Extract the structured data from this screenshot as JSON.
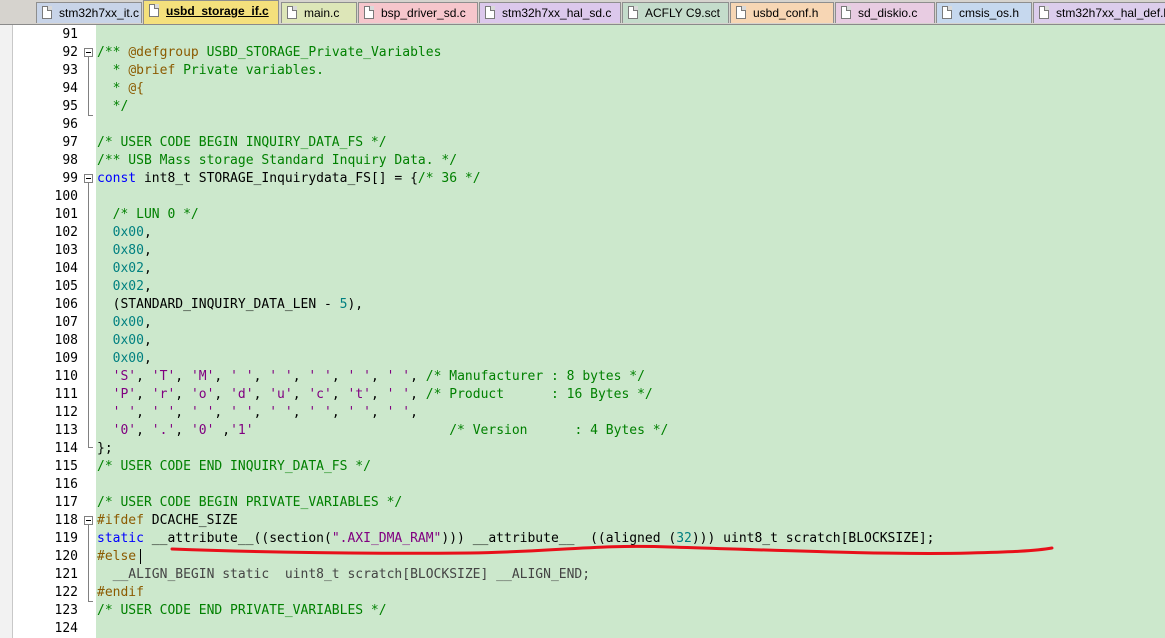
{
  "tabs": [
    {
      "label": "stm32h7xx_it.c",
      "color": "#c8d4e8",
      "active": false
    },
    {
      "label": "usbd_storage_if.c",
      "color": "#f4e07c",
      "active": true
    },
    {
      "label": "main.c",
      "color": "#dde6b8",
      "active": false
    },
    {
      "label": "bsp_driver_sd.c",
      "color": "#f6c6cc",
      "active": false
    },
    {
      "label": "stm32h7xx_hal_sd.c",
      "color": "#dcc8ec",
      "active": false
    },
    {
      "label": "ACFLY C9.sct",
      "color": "#c4dccb",
      "active": false
    },
    {
      "label": "usbd_conf.h",
      "color": "#f7d6b4",
      "active": false
    },
    {
      "label": "sd_diskio.c",
      "color": "#e8cce2",
      "active": false
    },
    {
      "label": "cmsis_os.h",
      "color": "#c6d8ee",
      "active": false
    },
    {
      "label": "stm32h7xx_hal_def.h",
      "color": "#dccdec",
      "active": false
    }
  ],
  "editor": {
    "lines": [
      {
        "n": "91",
        "segs": []
      },
      {
        "n": "92",
        "segs": [
          {
            "t": "/** ",
            "c": "com"
          },
          {
            "t": "@defgroup",
            "c": "pp"
          },
          {
            "t": " USBD_STORAGE_Private_Variables",
            "c": "com"
          }
        ]
      },
      {
        "n": "93",
        "segs": [
          {
            "t": "  * ",
            "c": "com"
          },
          {
            "t": "@brief",
            "c": "pp"
          },
          {
            "t": " Private variables.",
            "c": "com"
          }
        ]
      },
      {
        "n": "94",
        "segs": [
          {
            "t": "  * ",
            "c": "com"
          },
          {
            "t": "@{",
            "c": "pp"
          }
        ]
      },
      {
        "n": "95",
        "segs": [
          {
            "t": "  */",
            "c": "com"
          }
        ]
      },
      {
        "n": "96",
        "segs": []
      },
      {
        "n": "97",
        "segs": [
          {
            "t": "/* USER CODE BEGIN INQUIRY_DATA_FS */",
            "c": "com"
          }
        ]
      },
      {
        "n": "98",
        "segs": [
          {
            "t": "/** USB Mass storage Standard Inquiry Data. */",
            "c": "com"
          }
        ]
      },
      {
        "n": "99",
        "segs": [
          {
            "t": "const",
            "c": "kw"
          },
          {
            "t": " int8_t STORAGE_Inquirydata_FS[] = {",
            "c": "txt"
          },
          {
            "t": "/* 36 */",
            "c": "com"
          }
        ]
      },
      {
        "n": "100",
        "segs": []
      },
      {
        "n": "101",
        "segs": [
          {
            "t": "  /* LUN 0 */",
            "c": "com"
          }
        ]
      },
      {
        "n": "102",
        "segs": [
          {
            "t": "  0x00",
            "c": "num"
          },
          {
            "t": ",",
            "c": "txt"
          }
        ]
      },
      {
        "n": "103",
        "segs": [
          {
            "t": "  0x80",
            "c": "num"
          },
          {
            "t": ",",
            "c": "txt"
          }
        ]
      },
      {
        "n": "104",
        "segs": [
          {
            "t": "  0x02",
            "c": "num"
          },
          {
            "t": ",",
            "c": "txt"
          }
        ]
      },
      {
        "n": "105",
        "segs": [
          {
            "t": "  0x02",
            "c": "num"
          },
          {
            "t": ",",
            "c": "txt"
          }
        ]
      },
      {
        "n": "106",
        "segs": [
          {
            "t": "  (STANDARD_INQUIRY_DATA_LEN - ",
            "c": "txt"
          },
          {
            "t": "5",
            "c": "num"
          },
          {
            "t": "),",
            "c": "txt"
          }
        ]
      },
      {
        "n": "107",
        "segs": [
          {
            "t": "  0x00",
            "c": "num"
          },
          {
            "t": ",",
            "c": "txt"
          }
        ]
      },
      {
        "n": "108",
        "segs": [
          {
            "t": "  0x00",
            "c": "num"
          },
          {
            "t": ",",
            "c": "txt"
          }
        ]
      },
      {
        "n": "109",
        "segs": [
          {
            "t": "  0x00",
            "c": "num"
          },
          {
            "t": ",",
            "c": "txt"
          }
        ]
      },
      {
        "n": "110",
        "segs": [
          {
            "t": "  'S'",
            "c": "str"
          },
          {
            "t": ", ",
            "c": "txt"
          },
          {
            "t": "'T'",
            "c": "str"
          },
          {
            "t": ", ",
            "c": "txt"
          },
          {
            "t": "'M'",
            "c": "str"
          },
          {
            "t": ", ",
            "c": "txt"
          },
          {
            "t": "' '",
            "c": "str"
          },
          {
            "t": ", ",
            "c": "txt"
          },
          {
            "t": "' '",
            "c": "str"
          },
          {
            "t": ", ",
            "c": "txt"
          },
          {
            "t": "' '",
            "c": "str"
          },
          {
            "t": ", ",
            "c": "txt"
          },
          {
            "t": "' '",
            "c": "str"
          },
          {
            "t": ", ",
            "c": "txt"
          },
          {
            "t": "' '",
            "c": "str"
          },
          {
            "t": ", ",
            "c": "txt"
          },
          {
            "t": "/* Manufacturer : 8 bytes */",
            "c": "com"
          }
        ]
      },
      {
        "n": "111",
        "segs": [
          {
            "t": "  'P'",
            "c": "str"
          },
          {
            "t": ", ",
            "c": "txt"
          },
          {
            "t": "'r'",
            "c": "str"
          },
          {
            "t": ", ",
            "c": "txt"
          },
          {
            "t": "'o'",
            "c": "str"
          },
          {
            "t": ", ",
            "c": "txt"
          },
          {
            "t": "'d'",
            "c": "str"
          },
          {
            "t": ", ",
            "c": "txt"
          },
          {
            "t": "'u'",
            "c": "str"
          },
          {
            "t": ", ",
            "c": "txt"
          },
          {
            "t": "'c'",
            "c": "str"
          },
          {
            "t": ", ",
            "c": "txt"
          },
          {
            "t": "'t'",
            "c": "str"
          },
          {
            "t": ", ",
            "c": "txt"
          },
          {
            "t": "' '",
            "c": "str"
          },
          {
            "t": ", ",
            "c": "txt"
          },
          {
            "t": "/* Product      : 16 Bytes */",
            "c": "com"
          }
        ]
      },
      {
        "n": "112",
        "segs": [
          {
            "t": "  ' '",
            "c": "str"
          },
          {
            "t": ", ",
            "c": "txt"
          },
          {
            "t": "' '",
            "c": "str"
          },
          {
            "t": ", ",
            "c": "txt"
          },
          {
            "t": "' '",
            "c": "str"
          },
          {
            "t": ", ",
            "c": "txt"
          },
          {
            "t": "' '",
            "c": "str"
          },
          {
            "t": ", ",
            "c": "txt"
          },
          {
            "t": "' '",
            "c": "str"
          },
          {
            "t": ", ",
            "c": "txt"
          },
          {
            "t": "' '",
            "c": "str"
          },
          {
            "t": ", ",
            "c": "txt"
          },
          {
            "t": "' '",
            "c": "str"
          },
          {
            "t": ", ",
            "c": "txt"
          },
          {
            "t": "' '",
            "c": "str"
          },
          {
            "t": ",",
            "c": "txt"
          }
        ]
      },
      {
        "n": "113",
        "segs": [
          {
            "t": "  '0'",
            "c": "str"
          },
          {
            "t": ", ",
            "c": "txt"
          },
          {
            "t": "'.'",
            "c": "str"
          },
          {
            "t": ", ",
            "c": "txt"
          },
          {
            "t": "'0'",
            "c": "str"
          },
          {
            "t": " ,",
            "c": "txt"
          },
          {
            "t": "'1'",
            "c": "str"
          },
          {
            "t": "                         ",
            "c": "txt"
          },
          {
            "t": "/* Version      : 4 Bytes */",
            "c": "com"
          }
        ]
      },
      {
        "n": "114",
        "segs": [
          {
            "t": "};",
            "c": "txt"
          }
        ]
      },
      {
        "n": "115",
        "segs": [
          {
            "t": "/* USER CODE END INQUIRY_DATA_FS */",
            "c": "com"
          }
        ]
      },
      {
        "n": "116",
        "segs": []
      },
      {
        "n": "117",
        "segs": [
          {
            "t": "/* USER CODE BEGIN PRIVATE_VARIABLES */",
            "c": "com"
          }
        ]
      },
      {
        "n": "118",
        "segs": [
          {
            "t": "#ifdef",
            "c": "pp"
          },
          {
            "t": " DCACHE_SIZE",
            "c": "txt"
          }
        ]
      },
      {
        "n": "119",
        "segs": [
          {
            "t": "static",
            "c": "kw"
          },
          {
            "t": " __attribute__((section(",
            "c": "txt"
          },
          {
            "t": "\".AXI_DMA_RAM\"",
            "c": "str"
          },
          {
            "t": "))) __attribute__  ((aligned (",
            "c": "txt"
          },
          {
            "t": "32",
            "c": "num"
          },
          {
            "t": "))) uint8_t scratch[BLOCKSIZE];",
            "c": "txt"
          }
        ]
      },
      {
        "n": "120",
        "segs": [
          {
            "t": "#else",
            "c": "pp"
          }
        ]
      },
      {
        "n": "121",
        "segs": [
          {
            "t": "  __ALIGN_BEGIN static  uint8_t scratch[BLOCKSIZE] __ALIGN_END;",
            "c": "dim"
          }
        ]
      },
      {
        "n": "122",
        "segs": [
          {
            "t": "#endif",
            "c": "pp"
          }
        ]
      },
      {
        "n": "123",
        "segs": [
          {
            "t": "/* USER CODE END PRIVATE_VARIABLES */",
            "c": "com"
          }
        ]
      },
      {
        "n": "124",
        "segs": []
      }
    ]
  },
  "annotation": {
    "color": "#e8101a"
  }
}
